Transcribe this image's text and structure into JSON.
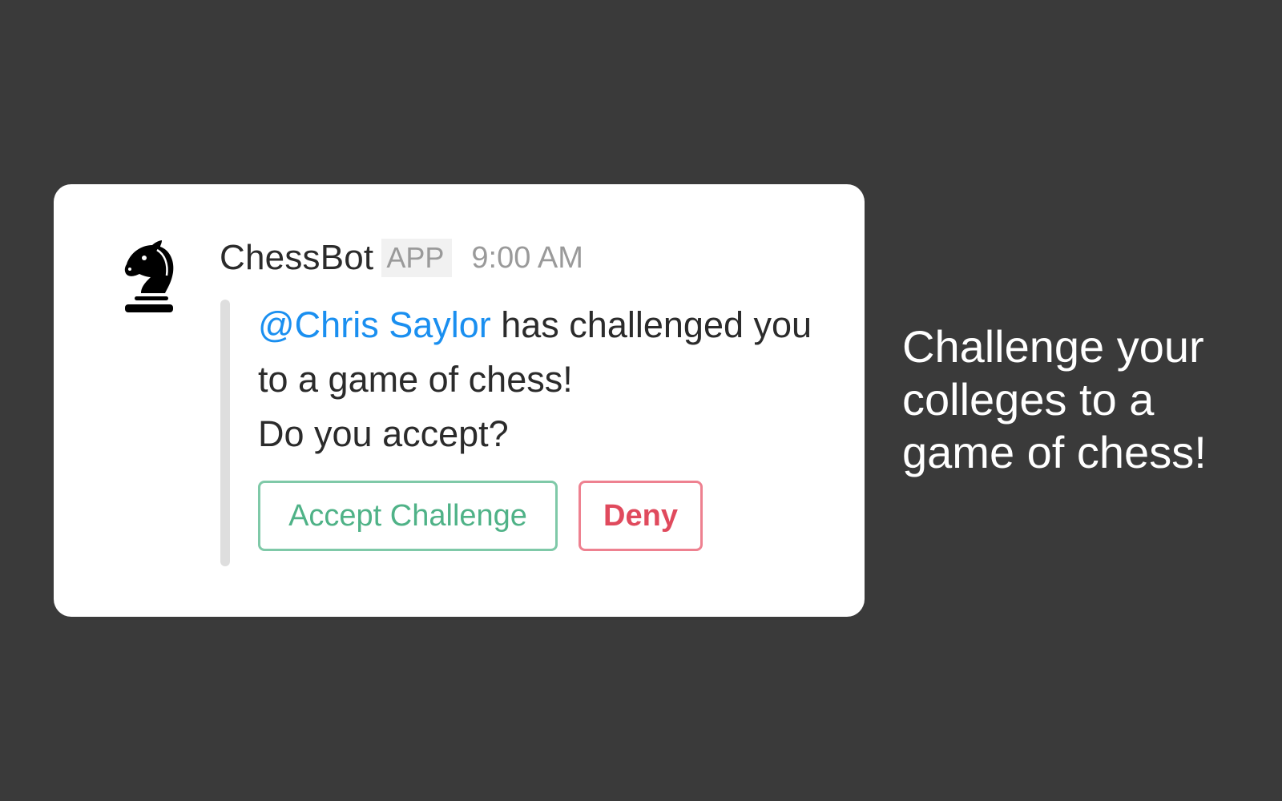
{
  "message": {
    "bot_name": "ChessBot",
    "badge": "APP",
    "time": "9:00 AM",
    "avatar_icon": "chess-knight-icon",
    "mention": "@Chris Saylor",
    "text_after_mention": " has challenged you to a game of chess!",
    "question": "Do you accept?",
    "accept_label": "Accept Challenge",
    "deny_label": "Deny"
  },
  "tagline": "Challenge your colleges to a game of chess!",
  "colors": {
    "background": "#3a3a3a",
    "card": "#ffffff",
    "mention": "#1a8ff0",
    "accept": "#4fb287",
    "deny": "#e04a5d"
  }
}
